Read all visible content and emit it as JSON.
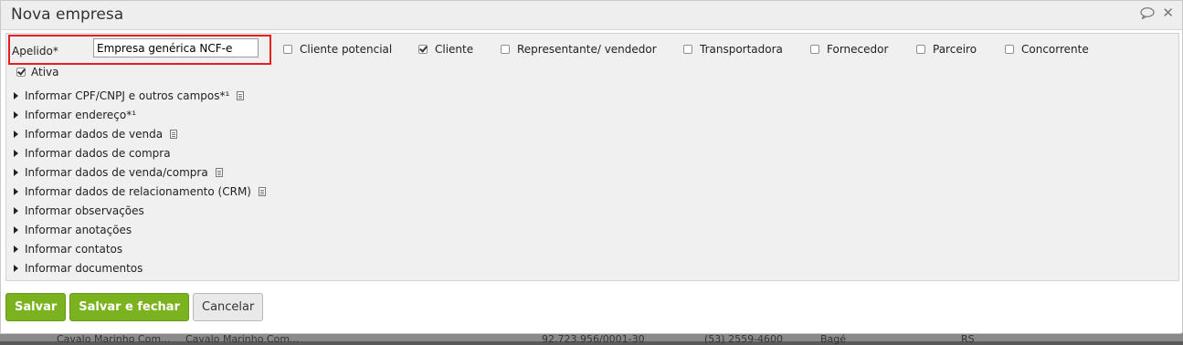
{
  "dialog": {
    "title": "Nova empresa"
  },
  "apelido": {
    "label": "Apelido*",
    "value": "Empresa genérica NCF-e"
  },
  "types": [
    {
      "label": "Cliente potencial",
      "checked": false
    },
    {
      "label": "Cliente",
      "checked": true
    },
    {
      "label": "Representante/ vendedor",
      "checked": false
    },
    {
      "label": "Transportadora",
      "checked": false
    },
    {
      "label": "Fornecedor",
      "checked": false
    },
    {
      "label": "Parceiro",
      "checked": false
    },
    {
      "label": "Concorrente",
      "checked": false
    }
  ],
  "ativa": {
    "label": "Ativa",
    "checked": true
  },
  "sections": [
    {
      "label": "Informar CPF/CNPJ e outros campos*¹",
      "has_icon": true
    },
    {
      "label": "Informar endereço*¹",
      "has_icon": false
    },
    {
      "label": "Informar dados de venda",
      "has_icon": true
    },
    {
      "label": "Informar dados de compra",
      "has_icon": false
    },
    {
      "label": "Informar dados de venda/compra",
      "has_icon": true
    },
    {
      "label": "Informar dados de relacionamento (CRM)",
      "has_icon": true
    },
    {
      "label": "Informar observações",
      "has_icon": false
    },
    {
      "label": "Informar anotações",
      "has_icon": false
    },
    {
      "label": "Informar contatos",
      "has_icon": false
    },
    {
      "label": "Informar documentos",
      "has_icon": false
    }
  ],
  "buttons": {
    "save": "Salvar",
    "save_close": "Salvar e fechar",
    "cancel": "Cancelar"
  },
  "background_row": {
    "cells": [
      "Cavalo Marinho Com...",
      "Cavalo Marinho Com...",
      "92.723.956/0001-30",
      "(53) 2559-4600",
      "Bagé",
      "RS"
    ]
  },
  "icons": {
    "chat": "speech-bubble-icon",
    "close": "close-icon",
    "expand": "triangle-right-icon",
    "note": "document-icon"
  }
}
